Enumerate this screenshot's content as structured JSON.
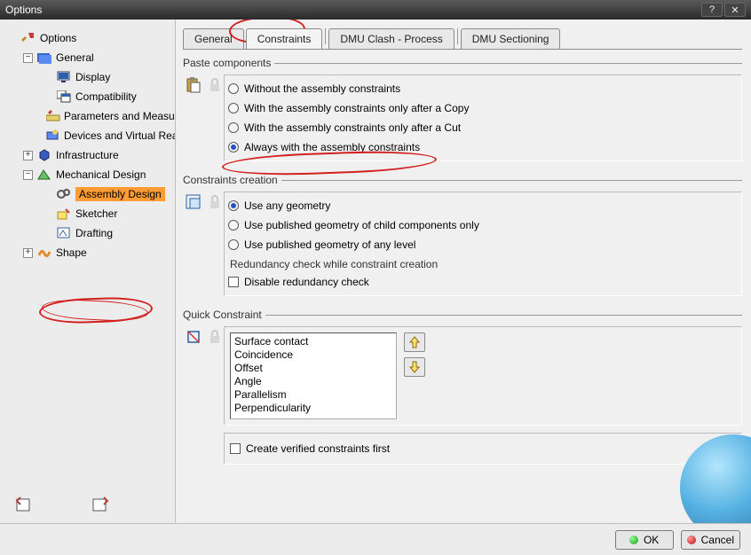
{
  "window": {
    "title": "Options"
  },
  "tree": {
    "root": "Options",
    "general": {
      "label": "General",
      "children": {
        "display": "Display",
        "compat": "Compatibility",
        "params": "Parameters and Measures",
        "devices": "Devices and Virtual Reality"
      }
    },
    "infra": {
      "label": "Infrastructure"
    },
    "mech": {
      "label": "Mechanical Design",
      "children": {
        "asm": "Assembly Design",
        "sketcher": "Sketcher",
        "drafting": "Drafting"
      }
    },
    "shape": {
      "label": "Shape"
    }
  },
  "tabs": {
    "general": "General",
    "constraints": "Constraints",
    "clash": "DMU Clash - Process",
    "section": "DMU Sectioning"
  },
  "paste": {
    "legend": "Paste components",
    "opt1": "Without the assembly constraints",
    "opt2": "With the assembly constraints only after a Copy",
    "opt3": "With the assembly constraints only after a Cut",
    "opt4": "Always with the assembly constraints"
  },
  "create": {
    "legend": "Constraints creation",
    "opt1": "Use any geometry",
    "opt2": "Use published geometry of child components only",
    "opt3": "Use published geometry of any level",
    "subhead": "Redundancy check while constraint creation",
    "chk": "Disable redundancy check"
  },
  "quick": {
    "legend": "Quick Constraint",
    "items": [
      "Surface contact",
      "Coincidence",
      "Offset",
      "Angle",
      "Parallelism",
      "Perpendicularity"
    ],
    "chk": "Create verified constraints first"
  },
  "footer": {
    "ok": "OK",
    "cancel": "Cancel"
  }
}
